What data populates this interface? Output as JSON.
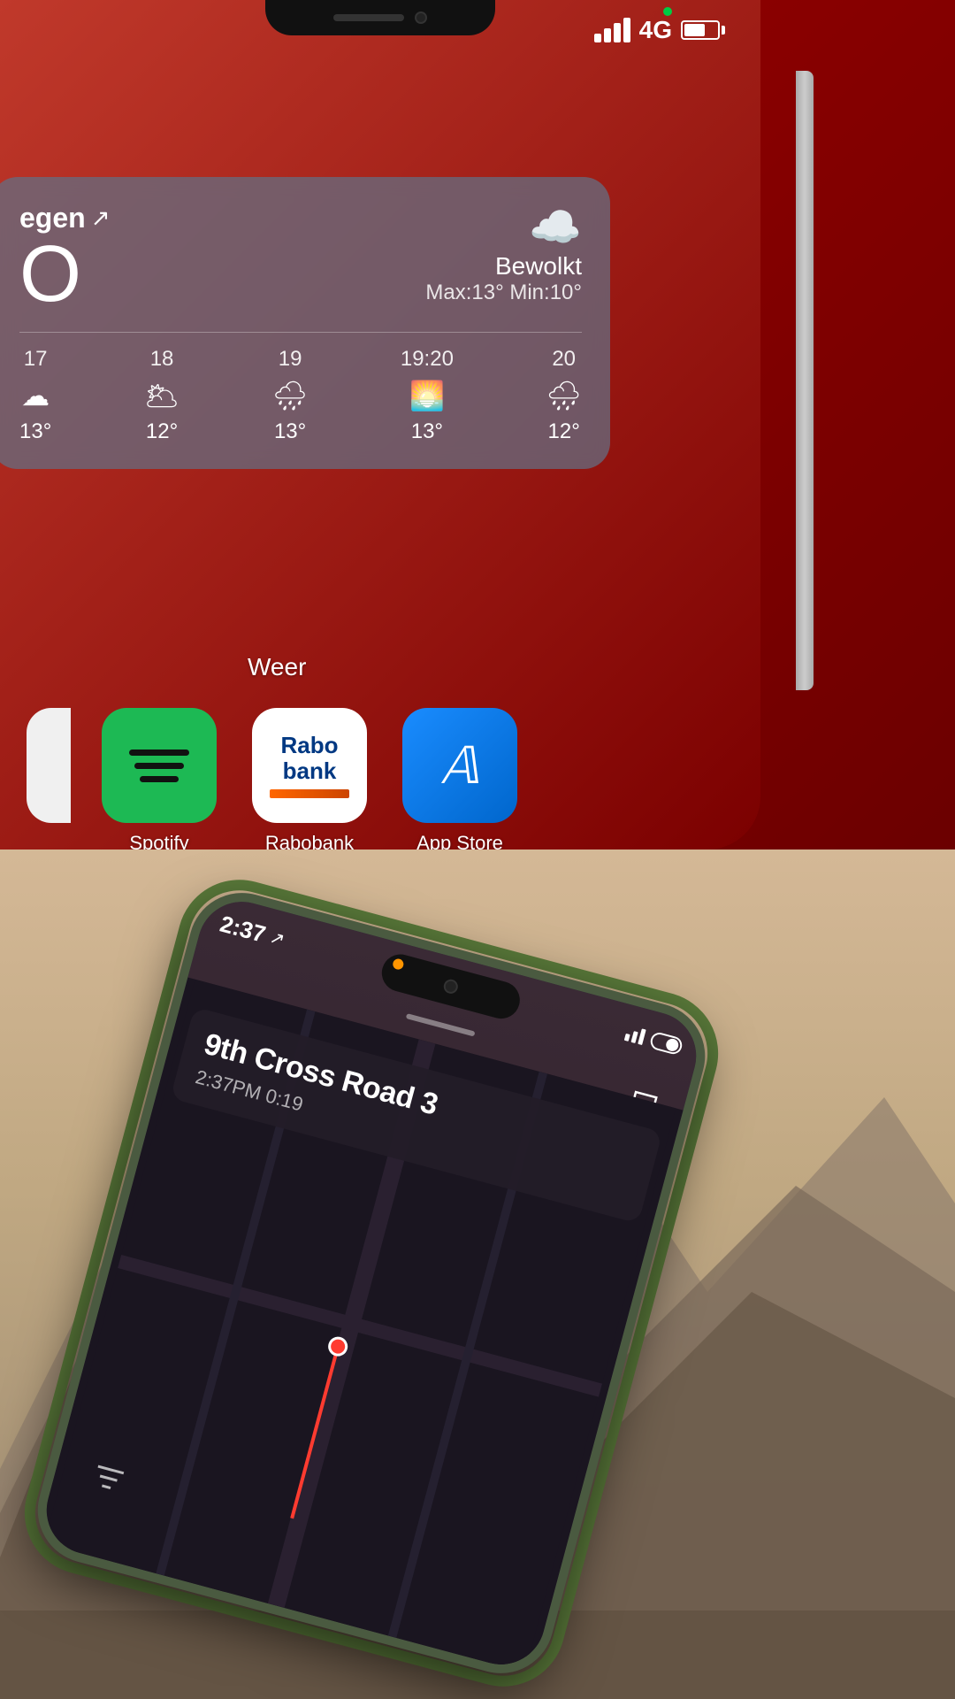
{
  "top_phone": {
    "status_bar": {
      "signal": "4G",
      "battery_percent": 65
    },
    "weather_widget": {
      "location": "egen",
      "location_arrow": "↗",
      "temperature": "O",
      "condition": "Bewolkt",
      "max_temp": "Max:13°",
      "min_temp": "Min:10°",
      "forecast": [
        {
          "day": "17",
          "icon": "☁️",
          "temp": "13°"
        },
        {
          "day": "18",
          "icon": "🌥️",
          "temp": "12°"
        },
        {
          "day": "19",
          "icon": "🌧️",
          "temp": "13°"
        },
        {
          "day": "19:20",
          "icon": "🌅",
          "temp": "13°"
        },
        {
          "day": "20",
          "icon": "🌧️",
          "temp": "12°"
        }
      ],
      "widget_label": "Weer"
    },
    "apps": [
      {
        "name": "Spotify",
        "label": "Spotify",
        "color": "#1DB954"
      },
      {
        "name": "Rabobank",
        "label": "Rabobank",
        "color": "#ffffff"
      },
      {
        "name": "App Store",
        "label": "App Store",
        "color": "#1a8cff"
      }
    ]
  },
  "bottom_phone": {
    "status_bar": {
      "time": "2:37",
      "time_arrow": "↗"
    },
    "navigation": {
      "street_name": "9th Cross Road 3",
      "time_display": "2:37PM  0:19"
    }
  }
}
